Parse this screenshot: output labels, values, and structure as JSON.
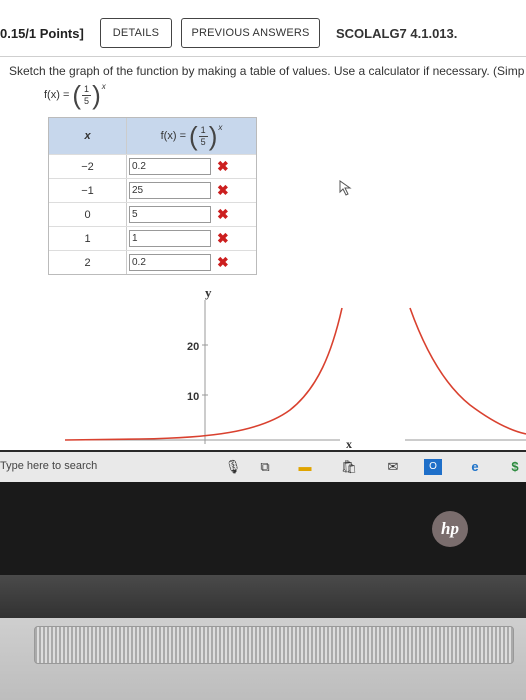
{
  "header": {
    "points": "0.15/1 Points]",
    "details_label": "DETAILS",
    "previous_answers_label": "PREVIOUS ANSWERS",
    "question_code": "SCOLALG7 4.1.013."
  },
  "prompt": "Sketch the graph of the function by making a table of values. Use a calculator if necessary. (Simp",
  "function": {
    "lhs": "f(x) =",
    "numerator": "1",
    "denominator": "5",
    "exponent": "x"
  },
  "table": {
    "x_header": "x",
    "rows": [
      {
        "x": "−2",
        "value": "0.2",
        "mark": "✖"
      },
      {
        "x": "−1",
        "value": "25",
        "mark": "✖"
      },
      {
        "x": "0",
        "value": "5",
        "mark": "✖"
      },
      {
        "x": "1",
        "value": "1",
        "mark": "✖"
      },
      {
        "x": "2",
        "value": "0.2",
        "mark": "✖"
      }
    ]
  },
  "graph": {
    "y_label": "y",
    "x_label": "x",
    "tick_20": "20",
    "tick_10": "10",
    "curve_color": "#d9412f"
  },
  "taskbar": {
    "search_placeholder": "Type here to search",
    "icons": [
      "microphone-icon",
      "task-view-icon",
      "file-explorer-icon",
      "store-icon",
      "mail-icon",
      "outlook-icon",
      "edge-icon",
      "dollar-icon"
    ]
  },
  "device": {
    "logo": "hp"
  }
}
